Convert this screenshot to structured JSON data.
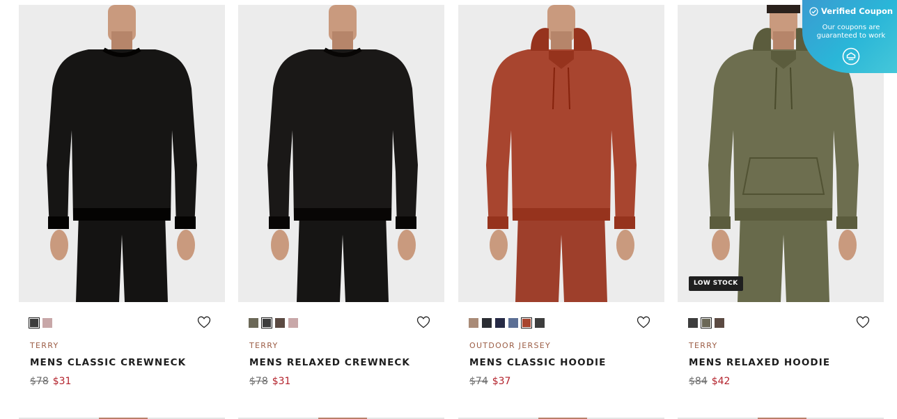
{
  "products": [
    {
      "category": "TERRY",
      "name": "MENS CLASSIC CREWNECK",
      "old_price": "$78",
      "sale_price": "$31",
      "badge": "",
      "garment_color": "#161514",
      "pants_color": "#141312",
      "style": "crewneck",
      "swatches": [
        "#3d3d3d",
        "#c8a7a8"
      ],
      "selected_swatch": 0
    },
    {
      "category": "TERRY",
      "name": "MENS RELAXED CREWNECK",
      "old_price": "$78",
      "sale_price": "$31",
      "badge": "",
      "garment_color": "#1a1817",
      "pants_color": "#161514",
      "style": "crewneck",
      "swatches": [
        "#6b6857",
        "#3d3d3d",
        "#5b4a42",
        "#c8a7a8"
      ],
      "selected_swatch": 1
    },
    {
      "category": "OUTDOOR JERSEY",
      "name": "MENS CLASSIC HOODIE",
      "old_price": "$74",
      "sale_price": "$37",
      "badge": "",
      "garment_color": "#a8452f",
      "pants_color": "#9e3f2b",
      "style": "hoodie",
      "swatches": [
        "#a98b77",
        "#2b2d33",
        "#262a45",
        "#5c6f95",
        "#a8452f",
        "#3d3d3d"
      ],
      "selected_swatch": 4
    },
    {
      "category": "TERRY",
      "name": "MENS RELAXED HOODIE",
      "old_price": "$84",
      "sale_price": "$42",
      "badge": "LOW STOCK",
      "garment_color": "#6d6e4f",
      "pants_color": "#686a4b",
      "style": "hoodie",
      "swatches": [
        "#3d3d3d",
        "#6b6857",
        "#5b4a42"
      ],
      "selected_swatch": 1
    }
  ],
  "coupon": {
    "title": "Verified Coupon",
    "line1": "Our coupons are",
    "line2": "guaranteed to work"
  },
  "colors": {
    "category": "#9b5c44",
    "sale": "#b3222c",
    "photo_bg": "#ececec"
  }
}
